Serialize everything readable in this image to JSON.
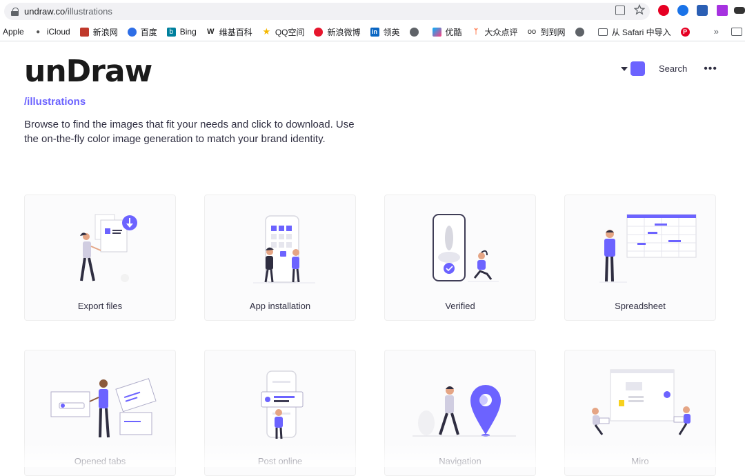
{
  "browser": {
    "url_host": "undraw.co",
    "url_path": "/illustrations",
    "bookmarks": [
      {
        "label": "Apple",
        "icon": "apple-icon"
      },
      {
        "label": "iCloud",
        "icon": "apple-icon"
      },
      {
        "label": "新浪网",
        "icon": "sina-icon"
      },
      {
        "label": "百度",
        "icon": "baidu-paw-icon"
      },
      {
        "label": "Bing",
        "icon": "bing-icon"
      },
      {
        "label": "维基百科",
        "icon": "wikipedia-icon"
      },
      {
        "label": "QQ空间",
        "icon": "star-icon"
      },
      {
        "label": "新浪微博",
        "icon": "weibo-icon"
      },
      {
        "label": "领英",
        "icon": "linkedin-icon"
      },
      {
        "label": "",
        "icon": "globe-icon"
      },
      {
        "label": "优酷",
        "icon": "youku-icon"
      },
      {
        "label": "大众点评",
        "icon": "dianping-icon"
      },
      {
        "label": "到到网",
        "icon": "tripadvisor-icon"
      },
      {
        "label": "",
        "icon": "globe-icon"
      },
      {
        "label": "从 Safari 中导入",
        "icon": "folder-icon"
      },
      {
        "label": "",
        "icon": "pinterest-icon"
      }
    ],
    "more": "»"
  },
  "header": {
    "logo": "unDraw",
    "breadcrumb": "/illustrations",
    "intro": "Browse to find the images that fit your needs and click to download. Use the on-the-fly color image generation to match your brand identity.",
    "search_label": "Search",
    "more_label": "•••",
    "accent_color": "#6c63ff"
  },
  "cards": [
    {
      "label": "Export files"
    },
    {
      "label": "App installation"
    },
    {
      "label": "Verified"
    },
    {
      "label": "Spreadsheet"
    },
    {
      "label": "Opened tabs"
    },
    {
      "label": "Post online"
    },
    {
      "label": "Navigation"
    },
    {
      "label": "Miro"
    }
  ]
}
